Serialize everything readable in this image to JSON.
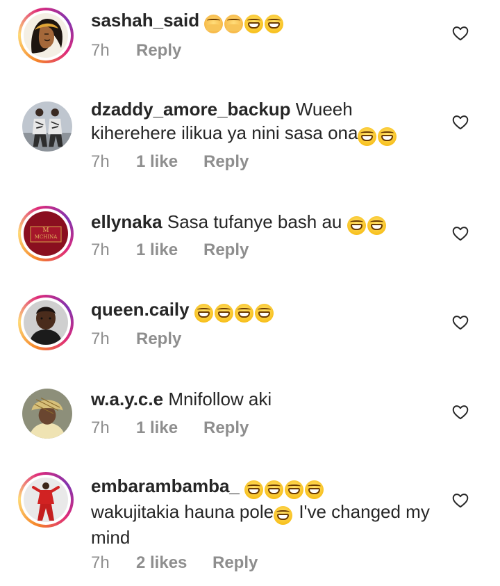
{
  "comments": [
    {
      "username": "sashah_said",
      "text": "",
      "emojis": [
        "hands-icon",
        "hands-icon",
        "grin-icon",
        "grin-icon"
      ],
      "time": "7h",
      "likes": "",
      "reply": "Reply",
      "avatar": "illustrated-woman-avatar"
    },
    {
      "username": "dzaddy_amore_backup",
      "text": "Wueeh kiherehere ilikua ya nini sasa ona",
      "emojis": [
        "grin-icon",
        "grin-icon"
      ],
      "time": "7h",
      "likes": "1 like",
      "reply": "Reply",
      "avatar": "couple-photo-avatar"
    },
    {
      "username": "ellynaka",
      "text": "Sasa tufanye bash au",
      "emojis": [
        "grin-icon",
        "grin-icon"
      ],
      "time": "7h",
      "likes": "1 like",
      "reply": "Reply",
      "avatar": "mchina-logo-avatar"
    },
    {
      "username": "queen.caily",
      "text": "",
      "emojis": [
        "grin-icon",
        "grin-icon",
        "grin-icon",
        "grin-icon"
      ],
      "time": "7h",
      "likes": "",
      "reply": "Reply",
      "avatar": "woman-portrait-avatar"
    },
    {
      "username": "w.a.y.c.e",
      "text": "Mnifollow aki",
      "emojis": [],
      "time": "7h",
      "likes": "1 like",
      "reply": "Reply",
      "avatar": "bucket-hat-avatar"
    },
    {
      "username": "embarambamba_",
      "text": "wakujitakia hauna pole",
      "text2": "I've changed my mind",
      "emojis": [
        "grin-icon",
        "grin-icon",
        "grin-icon",
        "grin-icon"
      ],
      "emojis_inline": [
        "grin-icon"
      ],
      "time": "7h",
      "likes": "2 likes",
      "reply": "Reply",
      "avatar": "red-suit-man-avatar"
    }
  ],
  "colors": {
    "text": "#262626",
    "muted": "#8e8e8e",
    "story_ring": [
      "#f58529",
      "#dd2a7b",
      "#8134af"
    ],
    "emoji_yellow": "#f5b400"
  },
  "heart_icon": "heart-outline-icon"
}
